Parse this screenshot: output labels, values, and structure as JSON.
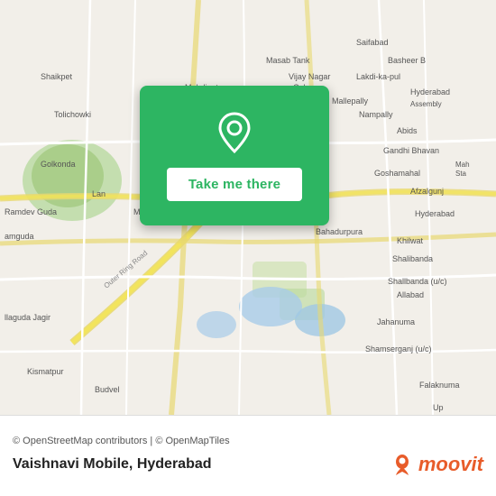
{
  "map": {
    "attribution": "© OpenStreetMap contributors | © OpenMapTiles",
    "card": {
      "button_label": "Take me there"
    }
  },
  "footer": {
    "location_name": "Vaishnavi Mobile, Hyderabad",
    "moovit_label": "moovit",
    "attribution": "© OpenStreetMap contributors | © OpenMapTiles"
  }
}
